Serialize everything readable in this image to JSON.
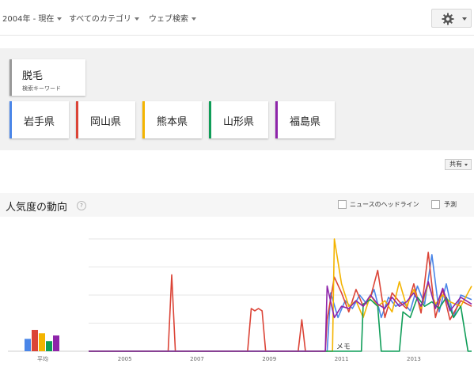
{
  "topbar": {
    "time_filter": "2004年 - 現在",
    "category_filter": "すべてのカテゴリ",
    "search_type_filter": "ウェブ検索"
  },
  "main_term": {
    "label": "脱毛",
    "sublabel": "検索キーワード",
    "color": "#999999"
  },
  "compare_terms": [
    {
      "label": "岩手県",
      "color": "#4a86e8"
    },
    {
      "label": "岡山県",
      "color": "#db4437"
    },
    {
      "label": "熊本県",
      "color": "#f4b400"
    },
    {
      "label": "山形県",
      "color": "#0f9d58"
    },
    {
      "label": "福島県",
      "color": "#8e24aa"
    }
  ],
  "share_label": "共有",
  "section": {
    "title": "人気度の動向",
    "headlines_label": "ニュースのヘッドライン",
    "forecast_label": "予測"
  },
  "chart_data": {
    "type": "line",
    "x_tick_labels": [
      "2005",
      "2007",
      "2009",
      "2011",
      "2013"
    ],
    "note_label": "メモ",
    "average_label": "平均",
    "ylim": [
      0,
      100
    ],
    "grid": true,
    "average_bars": [
      {
        "name": "岩手県",
        "value": 11
      },
      {
        "name": "岡山県",
        "value": 19
      },
      {
        "name": "熊本県",
        "value": 16
      },
      {
        "name": "山形県",
        "value": 9
      },
      {
        "name": "福島県",
        "value": 14
      }
    ],
    "series": [
      {
        "name": "岩手県",
        "color": "#4a86e8",
        "points": [
          [
            2004.0,
            0
          ],
          [
            2010.6,
            0
          ],
          [
            2010.7,
            52
          ],
          [
            2010.9,
            30
          ],
          [
            2011.1,
            45
          ],
          [
            2011.3,
            38
          ],
          [
            2011.5,
            50
          ],
          [
            2011.7,
            42
          ],
          [
            2011.9,
            55
          ],
          [
            2012.1,
            30
          ],
          [
            2012.3,
            48
          ],
          [
            2012.5,
            40
          ],
          [
            2012.7,
            44
          ],
          [
            2012.9,
            36
          ],
          [
            2013.1,
            58
          ],
          [
            2013.3,
            42
          ],
          [
            2013.5,
            86
          ],
          [
            2013.7,
            35
          ],
          [
            2013.9,
            60
          ],
          [
            2014.1,
            30
          ],
          [
            2014.3,
            50
          ],
          [
            2014.6,
            46
          ]
        ]
      },
      {
        "name": "岡山県",
        "color": "#db4437",
        "points": [
          [
            2004.0,
            0
          ],
          [
            2006.2,
            0
          ],
          [
            2006.3,
            68
          ],
          [
            2006.4,
            0
          ],
          [
            2008.4,
            0
          ],
          [
            2008.5,
            38
          ],
          [
            2008.6,
            36
          ],
          [
            2008.7,
            38
          ],
          [
            2008.8,
            36
          ],
          [
            2008.9,
            0
          ],
          [
            2009.8,
            0
          ],
          [
            2009.9,
            28
          ],
          [
            2010.0,
            0
          ],
          [
            2010.55,
            0
          ],
          [
            2010.6,
            28
          ],
          [
            2010.8,
            66
          ],
          [
            2011.0,
            52
          ],
          [
            2011.2,
            35
          ],
          [
            2011.4,
            55
          ],
          [
            2011.6,
            40
          ],
          [
            2011.8,
            48
          ],
          [
            2012.0,
            72
          ],
          [
            2012.2,
            30
          ],
          [
            2012.4,
            52
          ],
          [
            2012.6,
            44
          ],
          [
            2012.8,
            38
          ],
          [
            2013.0,
            60
          ],
          [
            2013.2,
            34
          ],
          [
            2013.4,
            88
          ],
          [
            2013.6,
            30
          ],
          [
            2013.8,
            55
          ],
          [
            2014.0,
            28
          ],
          [
            2014.3,
            45
          ],
          [
            2014.6,
            40
          ]
        ]
      },
      {
        "name": "熊本県",
        "color": "#f4b400",
        "points": [
          [
            2004.0,
            0
          ],
          [
            2010.75,
            0
          ],
          [
            2010.8,
            100
          ],
          [
            2011.0,
            60
          ],
          [
            2011.2,
            40
          ],
          [
            2011.4,
            45
          ],
          [
            2011.6,
            30
          ],
          [
            2011.8,
            50
          ],
          [
            2012.0,
            40
          ],
          [
            2012.2,
            45
          ],
          [
            2012.4,
            35
          ],
          [
            2012.6,
            62
          ],
          [
            2012.8,
            40
          ],
          [
            2013.0,
            55
          ],
          [
            2013.2,
            38
          ],
          [
            2013.4,
            60
          ],
          [
            2013.6,
            42
          ],
          [
            2013.8,
            50
          ],
          [
            2014.0,
            44
          ],
          [
            2014.3,
            40
          ],
          [
            2014.6,
            58
          ]
        ]
      },
      {
        "name": "山形県",
        "color": "#0f9d58",
        "points": [
          [
            2004.0,
            0
          ],
          [
            2011.55,
            0
          ],
          [
            2011.6,
            42
          ],
          [
            2011.8,
            46
          ],
          [
            2012.0,
            40
          ],
          [
            2012.1,
            0
          ],
          [
            2012.6,
            0
          ],
          [
            2012.7,
            35
          ],
          [
            2012.9,
            30
          ],
          [
            2013.1,
            48
          ],
          [
            2013.3,
            40
          ],
          [
            2013.5,
            44
          ],
          [
            2013.7,
            38
          ],
          [
            2013.9,
            48
          ],
          [
            2014.1,
            30
          ],
          [
            2014.3,
            40
          ],
          [
            2014.5,
            0
          ],
          [
            2014.6,
            0
          ]
        ]
      },
      {
        "name": "福島県",
        "color": "#8e24aa",
        "points": [
          [
            2004.0,
            0
          ],
          [
            2010.55,
            0
          ],
          [
            2010.6,
            58
          ],
          [
            2010.8,
            30
          ],
          [
            2011.0,
            40
          ],
          [
            2011.2,
            38
          ],
          [
            2011.4,
            45
          ],
          [
            2011.6,
            40
          ],
          [
            2011.8,
            50
          ],
          [
            2012.0,
            42
          ],
          [
            2012.2,
            38
          ],
          [
            2012.4,
            48
          ],
          [
            2012.6,
            40
          ],
          [
            2012.8,
            44
          ],
          [
            2013.0,
            52
          ],
          [
            2013.2,
            40
          ],
          [
            2013.4,
            62
          ],
          [
            2013.6,
            38
          ],
          [
            2013.8,
            56
          ],
          [
            2014.0,
            36
          ],
          [
            2014.3,
            48
          ],
          [
            2014.6,
            42
          ]
        ]
      }
    ]
  }
}
